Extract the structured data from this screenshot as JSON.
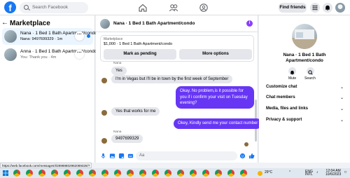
{
  "topbar": {
    "logo": "f",
    "search_placeholder": "Search Facebook",
    "find_friends": "Find friends",
    "icons": [
      "home-icon",
      "friends-icon",
      "groups-icon",
      "menu-grid-icon",
      "messenger-icon",
      "bell-icon",
      "account-icon"
    ]
  },
  "sidebar": {
    "title": "Marketplace",
    "conversations": [
      {
        "name": "Nana · 1 Bed 1 Bath Apartment/condo",
        "preview": "Nana: 9497699329 · 1m",
        "active": true,
        "unread": true
      },
      {
        "name": "Anna · 1 Bed 1 Bath Apartment/condo",
        "preview": "You: Thank you · 4m",
        "active": false,
        "unread": false
      }
    ]
  },
  "chat": {
    "title": "Nana · 1 Bed 1 Bath Apartment/condo",
    "listing": {
      "label": "Marketplace",
      "text": "$1,000 · 1 Bed 1 Bath Apartment/condo",
      "mark_pending": "Mark as pending",
      "more_options": "More options"
    },
    "messages": [
      {
        "sender": "Nana",
        "text": "Yes"
      },
      {
        "text": "I'm in Vegas but I'll be in town by the first week of September"
      },
      {
        "text": "Okay. No problem,is it possible for you if i confirm your visit on Tuesday evening?"
      },
      {
        "text": "Yes that works for me"
      },
      {
        "text": "Okey, Kindly send me your contact number"
      },
      {
        "sender": "Nana",
        "text": "9497699329"
      }
    ],
    "composer_placeholder": "Aa"
  },
  "details": {
    "name": "Nana · 1 Bed 1 Bath Apartment/condo",
    "mute": "Mute",
    "search": "Search",
    "sections": [
      "Customize chat",
      "Chat members",
      "Media, files and links",
      "Privacy & support"
    ]
  },
  "statusbar": {
    "url": "https://web.facebook.com/messages/t/28988802962089326/?"
  },
  "taskbar": {
    "temperature": "29°C",
    "language": "ENG",
    "region": "INTL",
    "time": "12:04 AM",
    "date": "10/6/2023"
  },
  "colors": {
    "accent": "#1877f2",
    "outgoing_bubble": "#6736f5",
    "info_icon": "#8b3dff"
  }
}
